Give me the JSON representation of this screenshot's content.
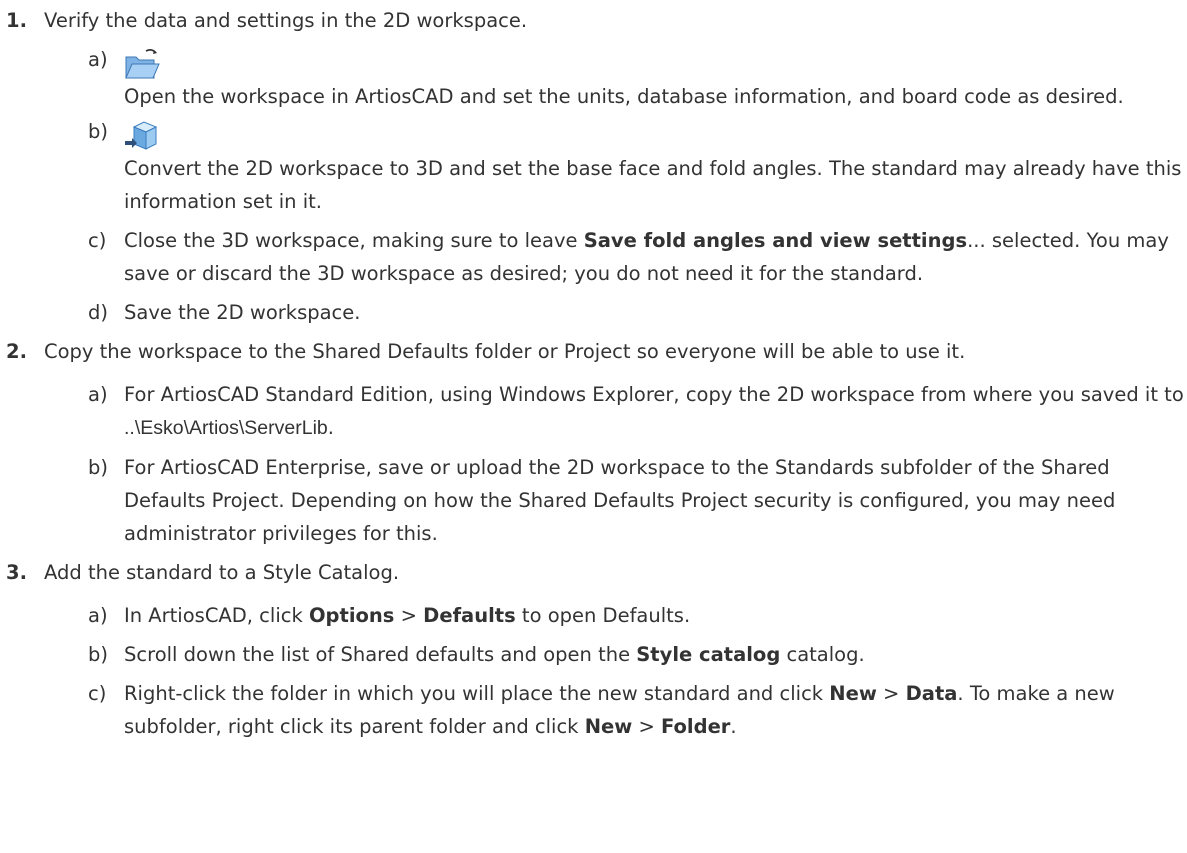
{
  "steps": [
    {
      "num": "1.",
      "text": "Verify the data and settings in the 2D workspace.",
      "substeps": [
        {
          "letter": "a)",
          "icon": "open-folder-icon",
          "text": "Open the workspace in ArtiosCAD and set the units, database information, and board code as desired."
        },
        {
          "letter": "b)",
          "icon": "convert-to-3d-icon",
          "text": "Convert the 2D workspace to 3D and set the base face and fold angles. The standard may already have this information set in it."
        },
        {
          "letter": "c)",
          "pre": "Close the 3D workspace, making sure to leave ",
          "bold": "Save fold angles and view settings",
          "post": "... selected. You may save or discard the 3D workspace as desired; you do not need it for the standard."
        },
        {
          "letter": "d)",
          "text": "Save the 2D workspace."
        }
      ]
    },
    {
      "num": "2.",
      "text": "Copy the workspace to the Shared Defaults folder or Project so everyone will be able to use it.",
      "substeps": [
        {
          "letter": "a)",
          "pre": "For ArtiosCAD Standard Edition, using Windows Explorer, copy the 2D workspace from where you saved it to ",
          "path": "..\\Esko\\Artios\\ServerLib",
          "post": "."
        },
        {
          "letter": "b)",
          "text": "For ArtiosCAD Enterprise, save or upload the 2D workspace to the Standards subfolder of the Shared Defaults Project. Depending on how the Shared Defaults Project security is configured, you may need administrator privileges for this."
        }
      ]
    },
    {
      "num": "3.",
      "text": "Add the standard to a Style Catalog.",
      "substeps": [
        {
          "letter": "a)",
          "t1": "In ArtiosCAD, click ",
          "b1": "Options",
          "t2": " > ",
          "b2": "Defaults",
          "t3": " to open Defaults."
        },
        {
          "letter": "b)",
          "t1": "Scroll down the list of Shared defaults and open the ",
          "b1": "Style catalog",
          "t2": " catalog."
        },
        {
          "letter": "c)",
          "t1": "Right-click the folder in which you will place the new standard and click ",
          "b1": "New",
          "t2": " > ",
          "b2": "Data",
          "t3": ". To make a new subfolder, right click its parent folder and click ",
          "b3": "New",
          "t4": " > ",
          "b4": "Folder",
          "t5": "."
        }
      ]
    }
  ]
}
